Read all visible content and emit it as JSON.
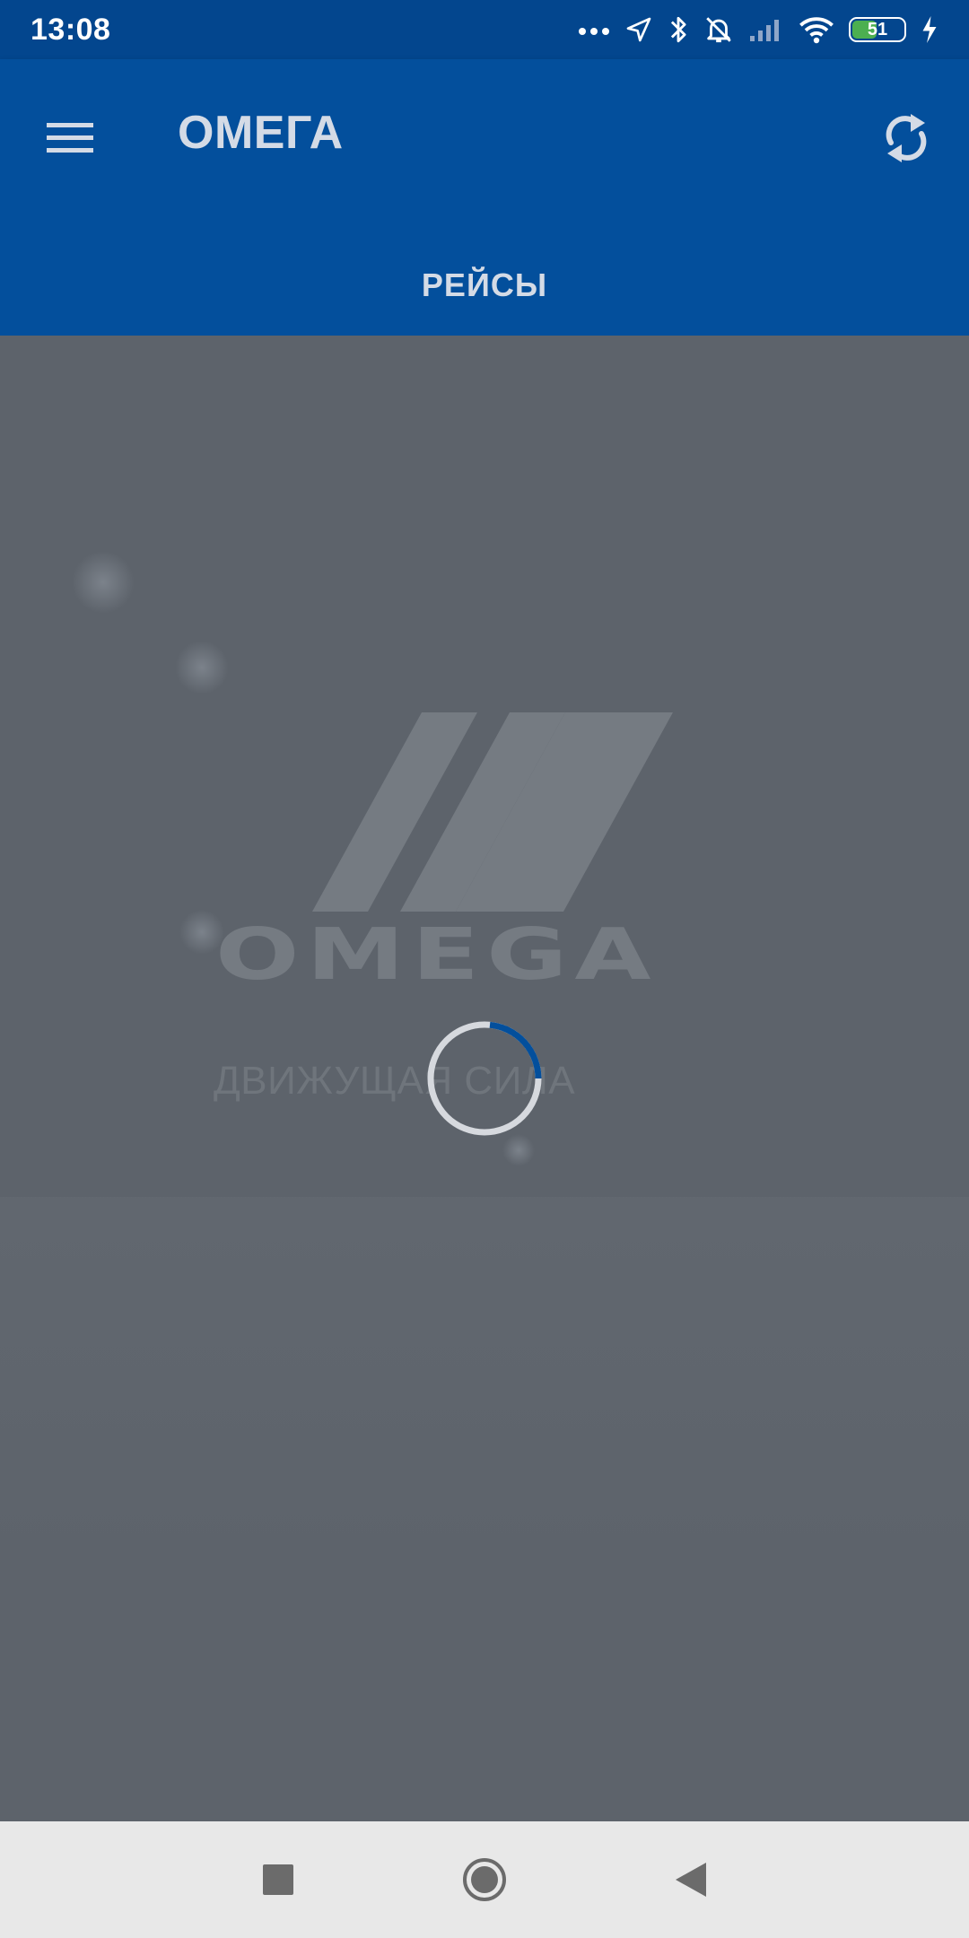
{
  "status_bar": {
    "time": "13:08",
    "battery_level": "51",
    "battery_fraction": 0.51,
    "icons": [
      "more-dots-icon",
      "location-arrow-icon",
      "bluetooth-icon",
      "bell-off-icon",
      "signal-icon",
      "wifi-icon",
      "battery-icon",
      "charging-bolt-icon"
    ]
  },
  "app_bar": {
    "title": "ОМЕГА",
    "menu_icon": "hamburger-menu-icon",
    "refresh_icon": "refresh-icon"
  },
  "tabs": [
    {
      "label": "РЕЙСЫ",
      "selected": true
    }
  ],
  "splash": {
    "logo_text": "OMEGA",
    "tagline": "ДВИЖУЩАЯ СИЛА",
    "loading": true
  },
  "nav_bar": {
    "icons": [
      "recents-square-icon",
      "home-circle-icon",
      "back-triangle-icon"
    ]
  },
  "colors": {
    "status_bar": "#03468e",
    "app_bar": "#034f9c",
    "content_bg": "#5d636b",
    "header_text": "#d4dbe6",
    "spinner_accent": "#034f9c",
    "nav_bar": "#e8e8e8"
  }
}
